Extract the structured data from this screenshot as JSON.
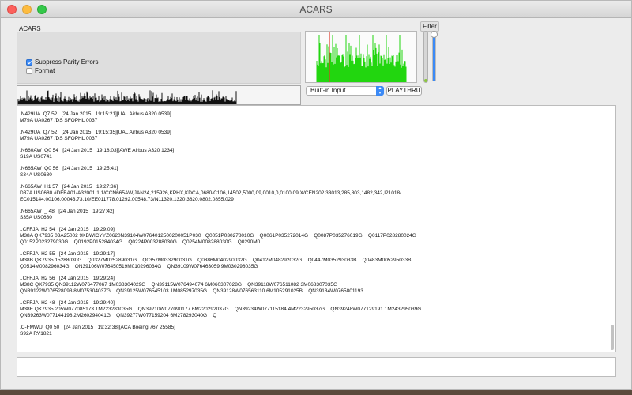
{
  "window": {
    "title": "ACARS"
  },
  "group": {
    "label": "ACARS",
    "suppress_parity": {
      "label": "Suppress Parity Errors",
      "checked": true
    },
    "format": {
      "label": "Format",
      "checked": false
    }
  },
  "audio": {
    "filter_label": "Filter",
    "input_select": "Built-in Input",
    "playthru_label": "PLAYTHRU"
  },
  "colors": {
    "spectrum": "#22d60f",
    "spectrum_marker": "#e03a2a",
    "accent": "#3b8af6",
    "waveform": "#111111"
  },
  "log": {
    "entries": [
      {
        "lines": [
          "S37A UA0267"
        ]
      },
      {
        "lines": [
          ".N429UA  Q7 52   [24 Jan 2015   19:15:21][UAL Airbus A320 0539]",
          "M79A UA0267 /DS SFOPHL 0037"
        ]
      },
      {
        "lines": [
          ".N429UA  Q7 52   [24 Jan 2015   19:15:35][UAL Airbus A320 0539]",
          "M79A UA0267 /DS SFOPHL 0037"
        ]
      },
      {
        "lines": [
          ".N660AW  Q0 54   [24 Jan 2015   19:18:03][AWE Airbus A320 1234]",
          "S19A US0741"
        ]
      },
      {
        "lines": [
          ".N665AW  Q0 56   [24 Jan 2015   19:25:41]",
          "S34A US0680"
        ]
      },
      {
        "lines": [
          ".N665AW  H1 57   [24 Jan 2015   19:27:36]",
          "D37A US0680 #DFBA01/A32001,1,1/CCN665AW,JAN24,215926,KPHX,KDCA,0680/C106,14502,5000,09,0010,0,0100,09,X/CEN202,33013,285,803,1482,342,I21018/",
          "EC015144,00106,00043,73,10/EE011778,01292,00548,73/N11320,1320,3820,0802,0855,029"
        ]
      },
      {
        "lines": [
          ".N665AW  _ 48   [24 Jan 2015   19:27:42]",
          "S35A US0680"
        ]
      },
      {
        "lines": [
          "..CFFJA  H2 54   [24 Jan 2015   19:29:09]",
          "M38A QK7935 03A25002 9KBWICYYZ0620N39104W0764012500200051P030   Q0051P030278010G    Q0061P035272014G    Q0087P035276019G    Q0117P028280024G",
          "Q0152P023279030G    Q0192P015284034G    Q0224P003288030G    Q0254M008288030G    Q0290M0"
        ]
      },
      {
        "lines": [
          "..CFFJA  H2 55   [24 Jan 2015   19:29:17]",
          "M38B QK7935 15288030G    Q0327M025289031G    Q0357M033290031G    Q0386M040290032G    Q0412M048292032G    Q0447M035293033B    Q0483M005295033B",
          "Q0514M008296034G    QN39106W076450519M010296034G    QN39109W076463059 9M030298035G"
        ]
      },
      {
        "lines": [
          "..CFFJA  H2 56   [24 Jan 2015   19:29:24]",
          "M38C QK7935 QN39112W076477067 1M038304029G    QN39115W076494074 6M060307028G    QN39118W076511082 3M068307035G",
          "QN39122W076528093 8M075304037G    QN39125W076545103 1M085297035G    QN39128W076563110 6M105291025B    QN39134W0765801193"
        ]
      },
      {
        "lines": [
          "..CFFJA  H2 48   [24 Jan 2015   19:29:40]",
          "M38E QK7935 205W077085173 1M223283035G    QN39210W077090177 6M220292037G    QN39234W077115184 4M223295037G    QN39248W077129191 1M243295039G",
          "QN39263W077144198 2M260294041G    QN39277W077159204 6M278293040G    Q"
        ]
      },
      {
        "lines": [
          ".C-FMWU  Q0 50   [24 Jan 2015   19:32:38][ACA Boeing 767 25585]",
          "S92A RV1821"
        ]
      }
    ]
  }
}
